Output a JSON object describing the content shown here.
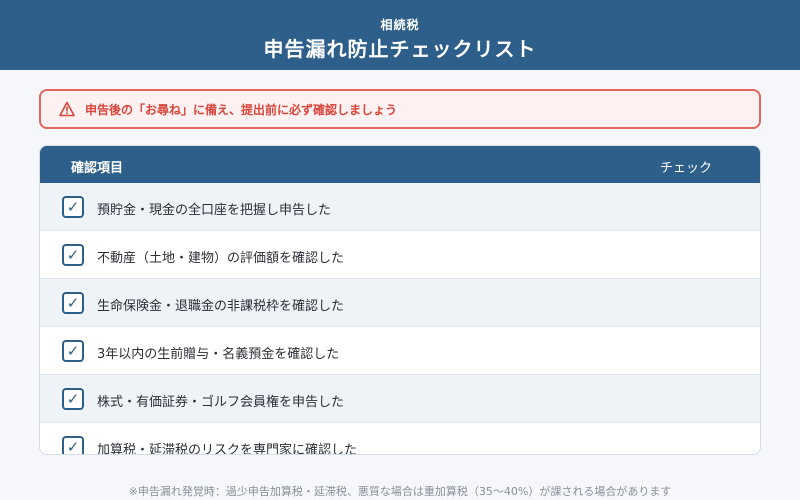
{
  "header": {
    "subtitle": "相続税",
    "title": "申告漏れ防止チェックリスト"
  },
  "alert": {
    "icon": "warning-icon",
    "text": "申告後の「お尋ね」に備え、提出前に必ず確認しましょう"
  },
  "table": {
    "col_item": "確認項目",
    "col_check": "チェック",
    "rows": [
      {
        "label": "預貯金・現金の全口座を把握し申告した",
        "checked": true,
        "mark": "✓"
      },
      {
        "label": "不動産（土地・建物）の評価額を確認した",
        "checked": true,
        "mark": "✓"
      },
      {
        "label": "生命保険金・退職金の非課税枠を確認した",
        "checked": true,
        "mark": "✓"
      },
      {
        "label": "3年以内の生前贈与・名義預金を確認した",
        "checked": true,
        "mark": "✓"
      },
      {
        "label": "株式・有価証券・ゴルフ会員権を申告した",
        "checked": true,
        "mark": "✓"
      },
      {
        "label": "加算税・延滞税のリスクを専門家に確認した",
        "checked": true,
        "mark": "✓"
      }
    ]
  },
  "footnote": "※申告漏れ発覚時：過少申告加算税・延滞税、悪質な場合は重加算税（35〜40%）が課される場合があります",
  "colors": {
    "primary": "#2d5f8a",
    "alert": "#d9463b",
    "alert_bg": "#fdf1f1",
    "row_alt": "#eef3f8"
  }
}
